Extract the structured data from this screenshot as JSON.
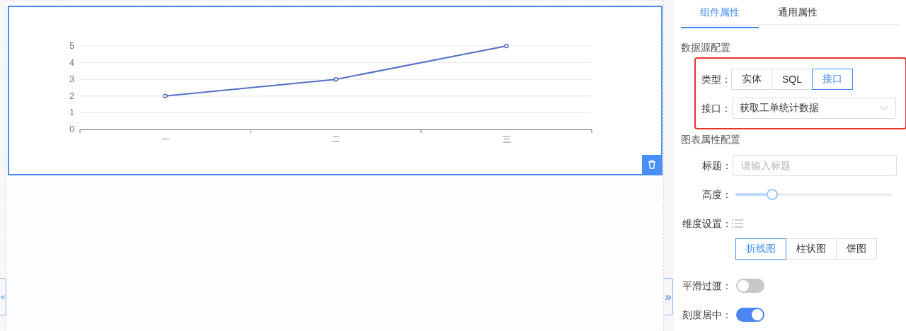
{
  "canvas": {
    "chart_data": {
      "type": "line",
      "categories": [
        "一",
        "二",
        "三"
      ],
      "series": [
        {
          "color": "#5470c6",
          "marker": true,
          "values": [
            2,
            3,
            5
          ]
        }
      ],
      "grid": true,
      "ylim": [
        0,
        5
      ],
      "yticks": [
        0,
        1,
        2,
        3,
        4,
        5
      ]
    }
  },
  "collapse_left": "«",
  "collapse_right": "»",
  "panel": {
    "tabs": [
      {
        "label": "组件属性",
        "selected": true
      },
      {
        "label": "通用属性",
        "selected": false
      }
    ],
    "data_source": {
      "title": "数据源配置",
      "highlighted": true,
      "type_label": "类型：",
      "types": [
        {
          "label": "实体",
          "selected": false
        },
        {
          "label": "SQL",
          "selected": false
        },
        {
          "label": "接口",
          "selected": true
        }
      ],
      "api_label": "接口：",
      "api_value": "获取工单统计数据"
    },
    "chart_props": {
      "title": "图表属性配置",
      "fields": [
        {
          "kind": "text",
          "label": "标题：",
          "placeholder": "请输入标题"
        },
        {
          "kind": "slider",
          "label": "高度：",
          "level": 0.23
        },
        {
          "kind": "dimension",
          "label": "维度设置："
        },
        {
          "kind": "segmented",
          "options": [
            {
              "label": "折线图",
              "selected": true
            },
            {
              "label": "柱状图",
              "selected": false
            },
            {
              "label": "饼图",
              "selected": false
            }
          ]
        },
        {
          "kind": "switch",
          "label": "平滑过渡：",
          "on": false
        },
        {
          "kind": "switch",
          "label": "刻度居中：",
          "on": true
        }
      ]
    }
  }
}
